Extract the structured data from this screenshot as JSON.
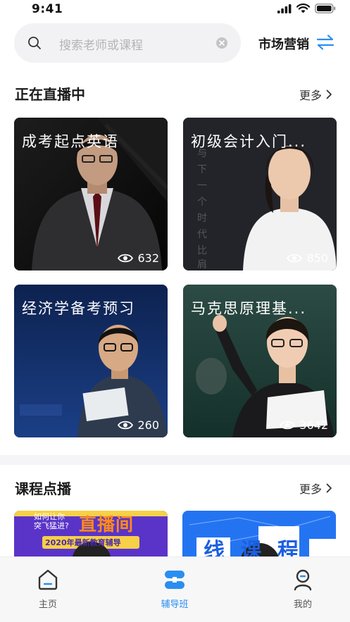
{
  "status_bar": {
    "time": "9:41"
  },
  "search": {
    "placeholder": "搜索老师或课程"
  },
  "category": {
    "label": "市场营销"
  },
  "live_section": {
    "title": "正在直播中",
    "more": "更多",
    "cards": [
      {
        "title": "成考起点英语",
        "views": "632"
      },
      {
        "title": "初级会计入门...",
        "views": "850"
      },
      {
        "title": "经济学备考预习",
        "views": "260"
      },
      {
        "title": "马克思原理基...",
        "views": "3642"
      }
    ]
  },
  "vod_section": {
    "title": "课程点播",
    "more": "更多",
    "thumbs": [
      {
        "line1": "如何让你",
        "line2": "突飞猛进?",
        "headline": "直播间",
        "banner": "2020年最新教育辅导"
      },
      {
        "headline": "线 课 程"
      }
    ]
  },
  "tab_bar": {
    "tabs": [
      {
        "label": "主页",
        "icon": "home-icon"
      },
      {
        "label": "辅导班",
        "icon": "class-icon"
      },
      {
        "label": "我的",
        "icon": "profile-icon"
      }
    ],
    "active_color": "#2a8ef0"
  }
}
